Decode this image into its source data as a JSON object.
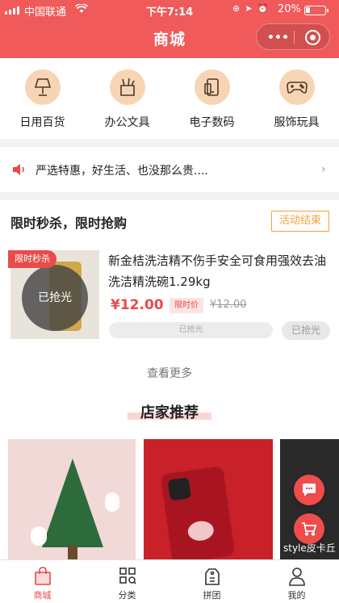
{
  "status": {
    "carrier": "中国联通",
    "time": "下午7:14",
    "battery": "20%"
  },
  "header": {
    "title": "商城"
  },
  "categories": [
    {
      "label": "日用百货",
      "icon": "lamp-icon"
    },
    {
      "label": "办公文具",
      "icon": "pen-holder-icon"
    },
    {
      "label": "电子数码",
      "icon": "phone-icon"
    },
    {
      "label": "服饰玩具",
      "icon": "gamepad-icon"
    }
  ],
  "notice": {
    "text": "严选特惠，好生活、也没那么贵...."
  },
  "flash_sale": {
    "title": "限时秒杀，限时抢购",
    "status": "活动结束",
    "product": {
      "tag": "限时秒杀",
      "overlay": "已抢光",
      "name": "新金桔洗洁精不伤手安全可食用强效去油洗洁精洗碗1.29kg",
      "price": "¥12.00",
      "price_label": "限时价",
      "old_price": "¥12.00",
      "progress_text": "已抢光",
      "button": "已抢光"
    },
    "more": "查看更多"
  },
  "recommend": {
    "title": "店家推荐",
    "item3_text": "style皮卡丘"
  },
  "tabs": [
    {
      "label": "商城",
      "icon": "shopping-bag-icon"
    },
    {
      "label": "分类",
      "icon": "grid-icon"
    },
    {
      "label": "拼团",
      "icon": "price-tag-icon"
    },
    {
      "label": "我的",
      "icon": "user-icon"
    }
  ],
  "colors": {
    "brand": "#f05a5a",
    "accent": "#e9484a",
    "warning": "#f2a03d"
  }
}
